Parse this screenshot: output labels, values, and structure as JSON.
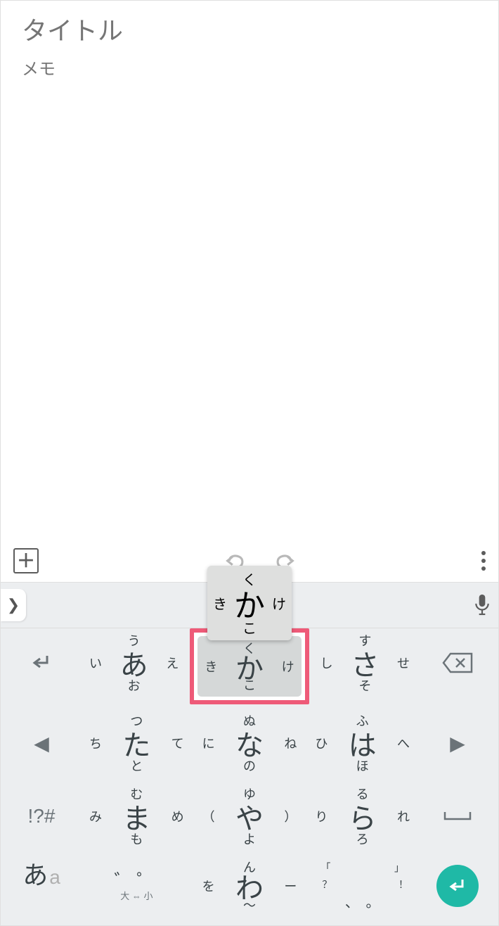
{
  "note": {
    "title_placeholder": "タイトル",
    "memo_placeholder": "メモ"
  },
  "popup": {
    "main": "か",
    "top": "く",
    "bottom": "こ",
    "left": "き",
    "right": "け"
  },
  "keyboard": {
    "side": {
      "return": "↵",
      "cursor_left": "◀",
      "cursor_right": "▶",
      "symbols": "!?#",
      "mode_jp": "あ",
      "mode_en": "a",
      "space": "⎵",
      "enter": "↵"
    },
    "rows": [
      [
        {
          "main": "あ",
          "top": "う",
          "bottom": "お",
          "left": "い",
          "right": "え"
        },
        {
          "main": "か",
          "top": "く",
          "bottom": "こ",
          "left": "き",
          "right": "け",
          "highlight": true
        },
        {
          "main": "さ",
          "top": "す",
          "bottom": "そ",
          "left": "し",
          "right": "せ"
        }
      ],
      [
        {
          "main": "た",
          "top": "つ",
          "bottom": "と",
          "left": "ち",
          "right": "て"
        },
        {
          "main": "な",
          "top": "ぬ",
          "bottom": "の",
          "left": "に",
          "right": "ね"
        },
        {
          "main": "は",
          "top": "ふ",
          "bottom": "ほ",
          "left": "ひ",
          "right": "へ"
        }
      ],
      [
        {
          "main": "ま",
          "top": "む",
          "bottom": "も",
          "left": "み",
          "right": "め"
        },
        {
          "main": "や",
          "top": "ゆ",
          "bottom": "よ",
          "left": "（",
          "right": "）"
        },
        {
          "main": "ら",
          "top": "る",
          "bottom": "ろ",
          "left": "り",
          "right": "れ"
        }
      ],
      [
        {
          "type": "marks",
          "marks": "゛゜",
          "sub": "大 ⇔ 小"
        },
        {
          "main": "わ",
          "top": "ん",
          "bottom": "〜",
          "left": "を",
          "right": "ー"
        },
        {
          "type": "punct",
          "main_left": "、",
          "main_right": "。",
          "tl": "「",
          "tr": "」",
          "bl": "？",
          "br": "！"
        }
      ]
    ]
  }
}
